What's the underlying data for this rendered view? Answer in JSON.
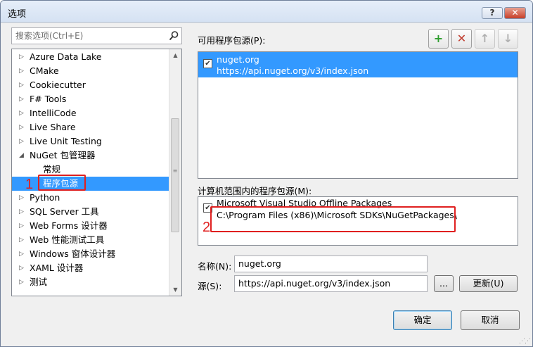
{
  "window": {
    "title": "选项",
    "help_label": "?",
    "close_label": "✕"
  },
  "search": {
    "placeholder": "搜索选项(Ctrl+E)"
  },
  "tree": {
    "items": [
      {
        "label": "Azure Data Lake",
        "arrow": "▷"
      },
      {
        "label": "CMake",
        "arrow": "▷"
      },
      {
        "label": "Cookiecutter",
        "arrow": "▷"
      },
      {
        "label": "F# Tools",
        "arrow": "▷"
      },
      {
        "label": "IntelliCode",
        "arrow": "▷"
      },
      {
        "label": "Live Share",
        "arrow": "▷"
      },
      {
        "label": "Live Unit Testing",
        "arrow": "▷"
      },
      {
        "label": "NuGet 包管理器",
        "arrow": "◢"
      },
      {
        "label": "常规"
      },
      {
        "label": "程序包源"
      },
      {
        "label": "Python",
        "arrow": "▷"
      },
      {
        "label": "SQL Server 工具",
        "arrow": "▷"
      },
      {
        "label": "Web Forms 设计器",
        "arrow": "▷"
      },
      {
        "label": "Web 性能测试工具",
        "arrow": "▷"
      },
      {
        "label": "Windows 窗体设计器",
        "arrow": "▷"
      },
      {
        "label": "XAML 设计器",
        "arrow": "▷"
      },
      {
        "label": "测试",
        "arrow": "▷"
      }
    ]
  },
  "available_sources": {
    "label": "可用程序包源(P):",
    "items": [
      {
        "name": "nuget.org",
        "url": "https://api.nuget.org/v3/index.json",
        "checked": true
      }
    ]
  },
  "toolbar": {
    "add": "+",
    "remove": "✕",
    "up": "↑",
    "down": "↓",
    "add_color": "#2e9e2e",
    "remove_color": "#c0392b"
  },
  "machine_sources": {
    "label": "计算机范围内的程序包源(M):",
    "items": [
      {
        "name": "Microsoft Visual Studio Offline Packages",
        "url": "C:\\Program Files (x86)\\Microsoft SDKs\\NuGetPackages\\",
        "checked": true
      }
    ]
  },
  "form": {
    "name_label": "名称(N):",
    "name_value": "nuget.org",
    "source_label": "源(S):",
    "source_value": "https://api.nuget.org/v3/index.json",
    "browse_label": "...",
    "update_label": "更新(U)"
  },
  "footer": {
    "ok_label": "确定",
    "cancel_label": "取消"
  },
  "annotations": [
    {
      "number": "1"
    },
    {
      "number": "2"
    }
  ],
  "colors": {
    "selection": "#3399ff",
    "annotation": "#e02020"
  }
}
